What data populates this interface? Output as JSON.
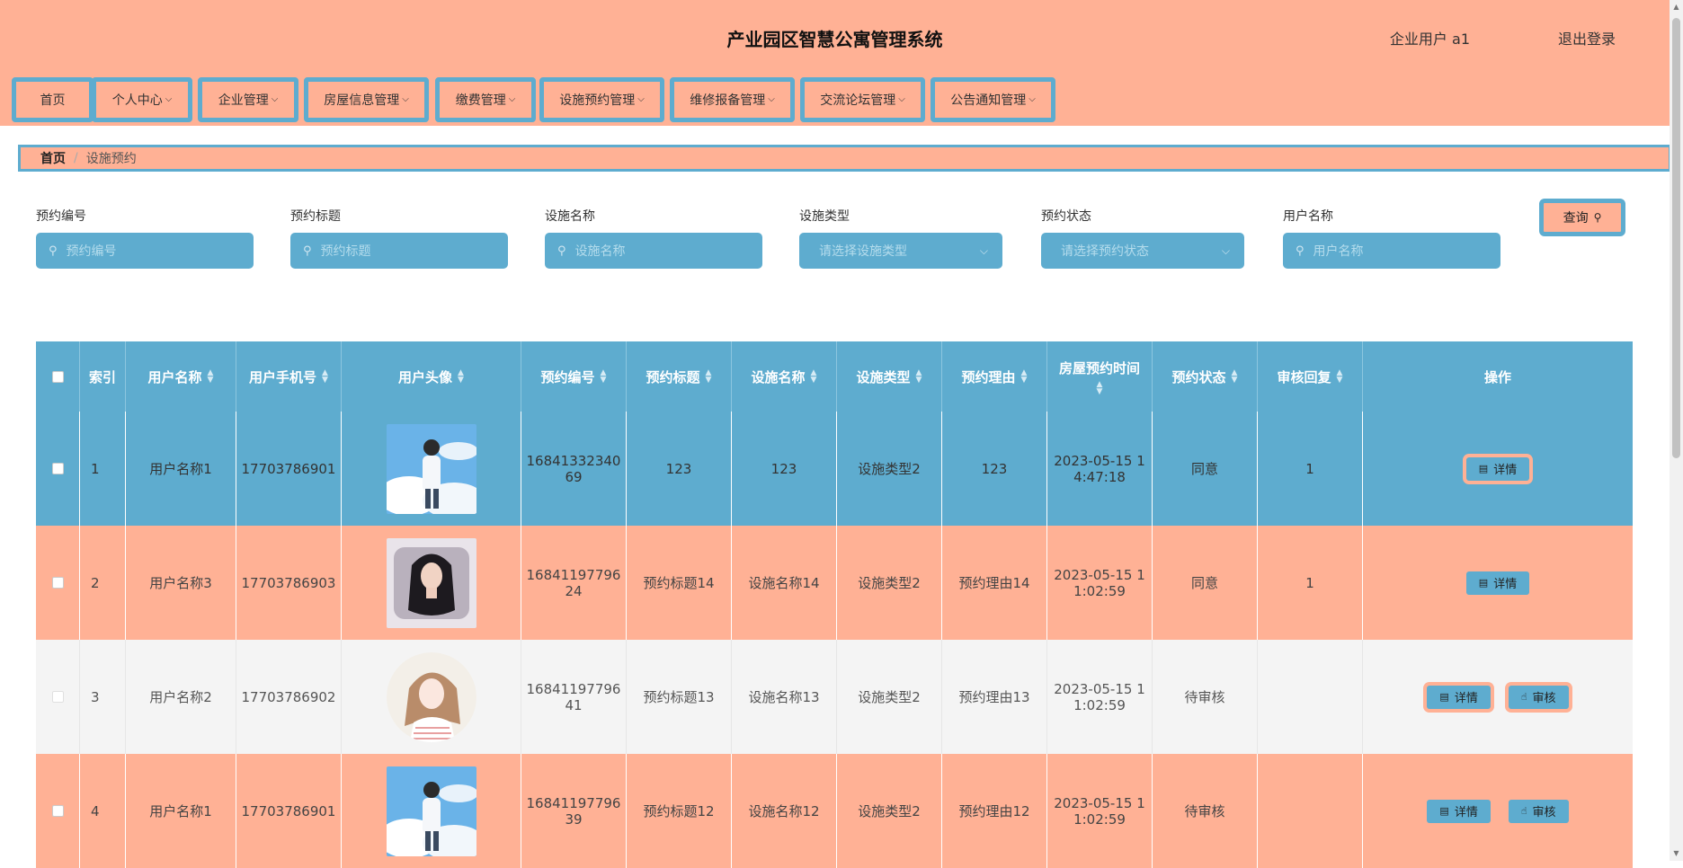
{
  "header": {
    "title": "产业园区智慧公寓管理系统",
    "user_info": "企业用户 a1",
    "logout": "退出登录"
  },
  "nav": {
    "items": [
      {
        "label": "首页",
        "has_dropdown": false
      },
      {
        "label": "个人中心",
        "has_dropdown": true
      },
      {
        "label": "企业管理",
        "has_dropdown": true
      },
      {
        "label": "房屋信息管理",
        "has_dropdown": true
      },
      {
        "label": "缴费管理",
        "has_dropdown": true
      },
      {
        "label": "设施预约管理",
        "has_dropdown": true
      },
      {
        "label": "维修报备管理",
        "has_dropdown": true
      },
      {
        "label": "交流论坛管理",
        "has_dropdown": true
      },
      {
        "label": "公告通知管理",
        "has_dropdown": true
      }
    ]
  },
  "breadcrumb": {
    "home": "首页",
    "current": "设施预约"
  },
  "filters": [
    {
      "label": "预约编号",
      "placeholder": "预约编号",
      "type": "input"
    },
    {
      "label": "预约标题",
      "placeholder": "预约标题",
      "type": "input"
    },
    {
      "label": "设施名称",
      "placeholder": "设施名称",
      "type": "input"
    },
    {
      "label": "设施类型",
      "placeholder": "请选择设施类型",
      "type": "select"
    },
    {
      "label": "预约状态",
      "placeholder": "请选择预约状态",
      "type": "select"
    },
    {
      "label": "用户名称",
      "placeholder": "用户名称",
      "type": "input"
    }
  ],
  "query_button": "查询",
  "table": {
    "columns": [
      "索引",
      "用户名称",
      "用户手机号",
      "用户头像",
      "预约编号",
      "预约标题",
      "设施名称",
      "设施类型",
      "预约理由",
      "房屋预约时间",
      "预约状态",
      "审核回复",
      "操作"
    ],
    "rows": [
      {
        "index": "1",
        "user": "用户名称1",
        "phone": "17703786901",
        "avatar": "boy-clouds",
        "code_a": "16841332340",
        "code_b": "69",
        "title": "123",
        "facility": "123",
        "ftype": "设施类型2",
        "reason": "123",
        "time_a": "2023-05-15 1",
        "time_b": "4:47:18",
        "status": "同意",
        "reply": "1",
        "actions": [
          "详情"
        ]
      },
      {
        "index": "2",
        "user": "用户名称3",
        "phone": "17703786903",
        "avatar": "woman-pillow",
        "code_a": "16841197796",
        "code_b": "24",
        "title": "预约标题14",
        "facility": "设施名称14",
        "ftype": "设施类型2",
        "reason": "预约理由14",
        "time_a": "2023-05-15 1",
        "time_b": "1:02:59",
        "status": "同意",
        "reply": "1",
        "actions": [
          "详情"
        ]
      },
      {
        "index": "3",
        "user": "用户名称2",
        "phone": "17703786902",
        "avatar": "girl-illustration",
        "code_a": "16841197796",
        "code_b": "41",
        "title": "预约标题13",
        "facility": "设施名称13",
        "ftype": "设施类型2",
        "reason": "预约理由13",
        "time_a": "2023-05-15 1",
        "time_b": "1:02:59",
        "status": "待审核",
        "reply": "",
        "actions": [
          "详情",
          "审核"
        ]
      },
      {
        "index": "4",
        "user": "用户名称1",
        "phone": "17703786901",
        "avatar": "boy-clouds",
        "code_a": "16841197796",
        "code_b": "39",
        "title": "预约标题12",
        "facility": "设施名称12",
        "ftype": "设施类型2",
        "reason": "预约理由12",
        "time_a": "2023-05-15 1",
        "time_b": "1:02:59",
        "status": "待审核",
        "reply": "",
        "actions": [
          "详情",
          "审核"
        ]
      }
    ]
  },
  "colors": {
    "primary_blue": "#5eaccf",
    "peach": "#ffb195",
    "row_gray": "#f4f4f4"
  }
}
